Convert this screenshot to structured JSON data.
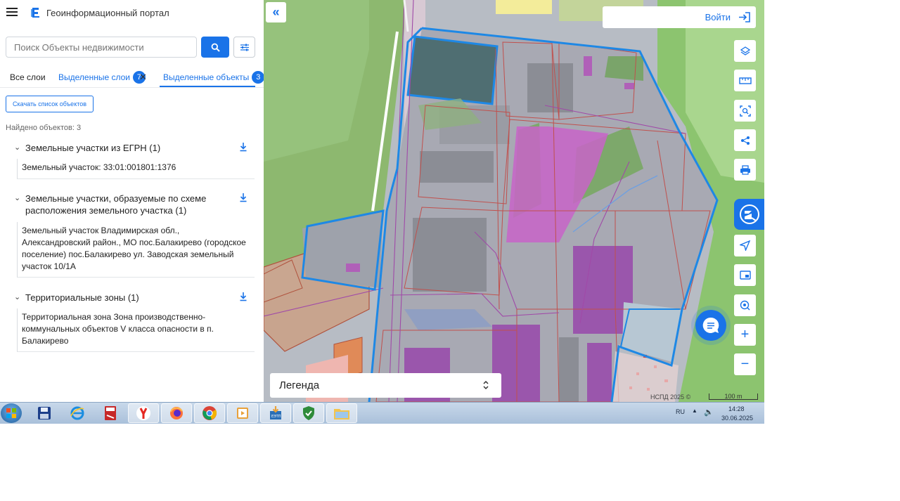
{
  "app": {
    "title": "Геоинформационный портал"
  },
  "search": {
    "placeholder": "Поиск Объекты недвижимости"
  },
  "tabs": [
    {
      "label": "Все слои"
    },
    {
      "label": "Выделенные слои",
      "count": "7"
    },
    {
      "label": "Выделенные объекты",
      "count": "3"
    }
  ],
  "results": {
    "download_label": "Скачать список объектов",
    "found_text": "Найдено объектов: 3",
    "groups": [
      {
        "title": "Земельные участки из ЕГРН (1)",
        "items": [
          "Земельный участок: 33:01:001801:1376"
        ]
      },
      {
        "title": "Земельные участки, образуемые по схеме расположения земельного участка (1)",
        "items": [
          "Земельный участок Владимирская обл., Александровский район., МО пос.Балакирево (городское поселение) пос.Балакирево ул. Заводская земельный участок 10/1А"
        ]
      },
      {
        "title": "Территориальные зоны (1)",
        "items": [
          "Территориальная зона Зона производственно-коммунальных объектов V класса опасности в п. Балакирево"
        ]
      }
    ]
  },
  "map": {
    "login_label": "Войти",
    "legend_label": "Легенда",
    "attribution": "НСПД 2025 ©",
    "scale_label": "100 m",
    "tools": [
      "layers-icon",
      "ruler-icon",
      "select-area-icon",
      "share-icon",
      "print-icon",
      "locate-icon",
      "minimap-icon",
      "geo-search-icon",
      "zoom-in-icon",
      "zoom-out-icon"
    ]
  },
  "taskbar": {
    "apps": [
      "save-icon",
      "ie-icon",
      "pdf-icon",
      "yandex-icon",
      "firefox-icon",
      "chrome-icon",
      "media-player-icon",
      "etp-icon",
      "shield-icon",
      "folder-icon"
    ],
    "active": [
      "yandex-icon",
      "chrome-icon",
      "media-player-icon",
      "etp-icon",
      "shield-icon",
      "folder-icon"
    ],
    "lang": "RU",
    "time": "14:28",
    "date": "30.06.2025"
  },
  "colors": {
    "accent": "#1a73e8",
    "selection": "#1e88e5",
    "zone_pink": "#c864c8",
    "zone_purple": "#a050b0"
  }
}
